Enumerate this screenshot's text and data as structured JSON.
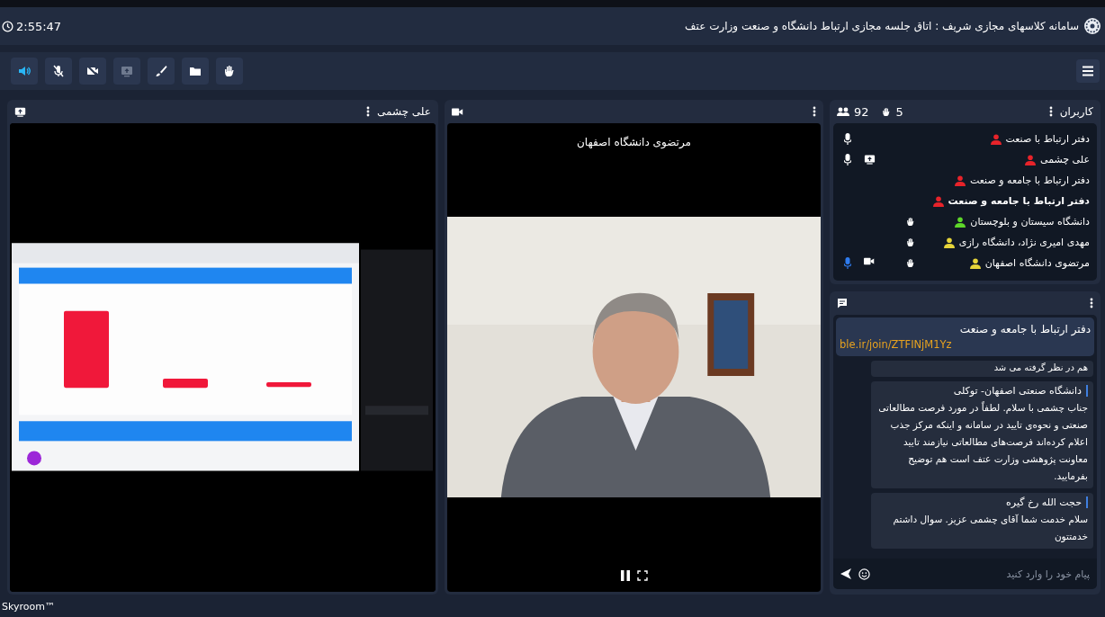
{
  "header": {
    "time": "2:55:47",
    "title": "سامانه کلاسهای مجازی شریف : اتاق جلسه مجازی ارتباط دانشگاه و صنعت وزارت عتف"
  },
  "toolbar": [
    {
      "kind": "speaker",
      "on": true,
      "disabled": false
    },
    {
      "kind": "mic",
      "on": false,
      "disabled": false
    },
    {
      "kind": "camera",
      "on": false,
      "disabled": false
    },
    {
      "kind": "screen",
      "on": false,
      "disabled": true
    },
    {
      "kind": "brush",
      "on": false,
      "disabled": false
    },
    {
      "kind": "folder",
      "on": false,
      "disabled": false
    },
    {
      "kind": "hand",
      "on": false,
      "disabled": false
    }
  ],
  "share_panel": {
    "title": "علی چشمی"
  },
  "video_panel": {
    "caption": "مرتضوی دانشگاه اصفهان"
  },
  "users_panel": {
    "title": "کاربران",
    "user_count": "92",
    "hand_count": "5",
    "users": [
      {
        "name": "دفتر ارتباط با صنعت",
        "color": "#e8232a",
        "emphasized": false,
        "mic_on": true,
        "speaking": false,
        "sharing_screen": false,
        "camera": false,
        "hand_raised": false
      },
      {
        "name": "علی چشمی",
        "color": "#e8232a",
        "emphasized": false,
        "mic_on": true,
        "speaking": false,
        "sharing_screen": true,
        "camera": false,
        "hand_raised": false
      },
      {
        "name": "دفتر ارتباط با جامعه و صنعت",
        "color": "#e8232a",
        "emphasized": false,
        "mic_on": false,
        "sharing_screen": false,
        "camera": false,
        "hand_raised": false
      },
      {
        "name": "دفتر ارتباط با جامعه و صنعت",
        "color": "#e8232a",
        "emphasized": true,
        "mic_on": false,
        "sharing_screen": false,
        "camera": false,
        "hand_raised": false
      },
      {
        "name": "دانشگاه سیستان و بلوچستان",
        "color": "#5ed62a",
        "emphasized": false,
        "mic_on": false,
        "sharing_screen": false,
        "camera": false,
        "hand_raised": true
      },
      {
        "name": "مهدی امیری نژاد، دانشگاه رازی",
        "color": "#e6d43a",
        "emphasized": false,
        "mic_on": false,
        "sharing_screen": false,
        "camera": false,
        "hand_raised": true
      },
      {
        "name": "مرتضوی دانشگاه اصفهان",
        "color": "#e6d43a",
        "emphasized": false,
        "mic_on": true,
        "speaking": true,
        "sharing_screen": false,
        "camera": true,
        "hand_raised": true
      }
    ]
  },
  "chat_panel": {
    "pinned": {
      "author": "دفتر ارتباط با جامعه و صنعت",
      "link": "ble.ir/join/ZTFINjM1Yz"
    },
    "partial_message": "هم در نظر گرفته می شد",
    "messages": [
      {
        "author": "دانشگاه صنعتی اصفهان- توکلی",
        "text": "جناب چشمی با سلام. لطفاً در مورد فرصت مطالعاتی صنعتی و نحوه‌ی تایید در سامانه و اینکه مرکز جذب اعلام کرده‌اند فرصت‌های مطالعاتی نیازمند تایید معاونت پژوهشی وزارت عتف است هم توضیح بفرمایید."
      },
      {
        "author": "حجت الله رخ گیره",
        "text": "سلام خدمت شما آقای چشمی عزیز. سوال داشتم خدمتتون"
      }
    ],
    "placeholder": "پیام خود را وارد کنید"
  },
  "footer": "Skyroom™"
}
